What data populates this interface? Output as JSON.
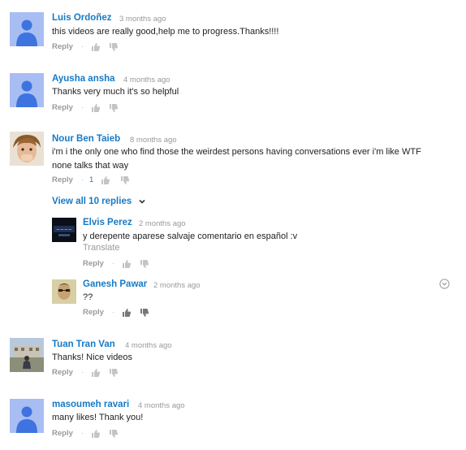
{
  "comments": [
    {
      "author": "Luis Ordoñez",
      "time": "3 months ago",
      "text": "this videos are really good,help me to progress.Thanks!!!!",
      "reply_label": "Reply",
      "avatar": "default-avatar"
    },
    {
      "author": "Ayusha ansha",
      "time": "4 months ago",
      "text": "Thanks very much it's so helpful",
      "reply_label": "Reply",
      "avatar": "default-avatar"
    },
    {
      "author": "Nour Ben Taieb",
      "time": "8 months ago",
      "text": "i'm i the only one who find those the weirdest persons having conversations ever i'm like WTF\nnone talks that way",
      "reply_label": "Reply",
      "like_count": "1",
      "avatar": "photo-avatar"
    },
    {
      "author": "Tuan Tran Van",
      "time": "4 months ago",
      "text": "Thanks! Nice videos",
      "reply_label": "Reply",
      "avatar": "photo-avatar"
    },
    {
      "author": "masoumeh ravari",
      "time": "4 months ago",
      "text": "many likes! Thank you!",
      "reply_label": "Reply",
      "avatar": "default-avatar"
    }
  ],
  "view_replies_label": "View all 10 replies",
  "replies": [
    {
      "author": "Elvis Perez",
      "time": "2 months ago",
      "text": "y derepente aparese salvaje comentario en español :v",
      "translate_label": "Translate",
      "reply_label": "Reply",
      "avatar": "photo-avatar"
    },
    {
      "author": "Ganesh Pawar",
      "time": "2 months ago",
      "text": "??",
      "reply_label": "Reply",
      "avatar": "photo-avatar"
    }
  ],
  "separator": "·",
  "colors": {
    "author": "#167ac6",
    "default_avatar_bg": "#a8bef3",
    "default_avatar_fg": "#3e73e0"
  }
}
